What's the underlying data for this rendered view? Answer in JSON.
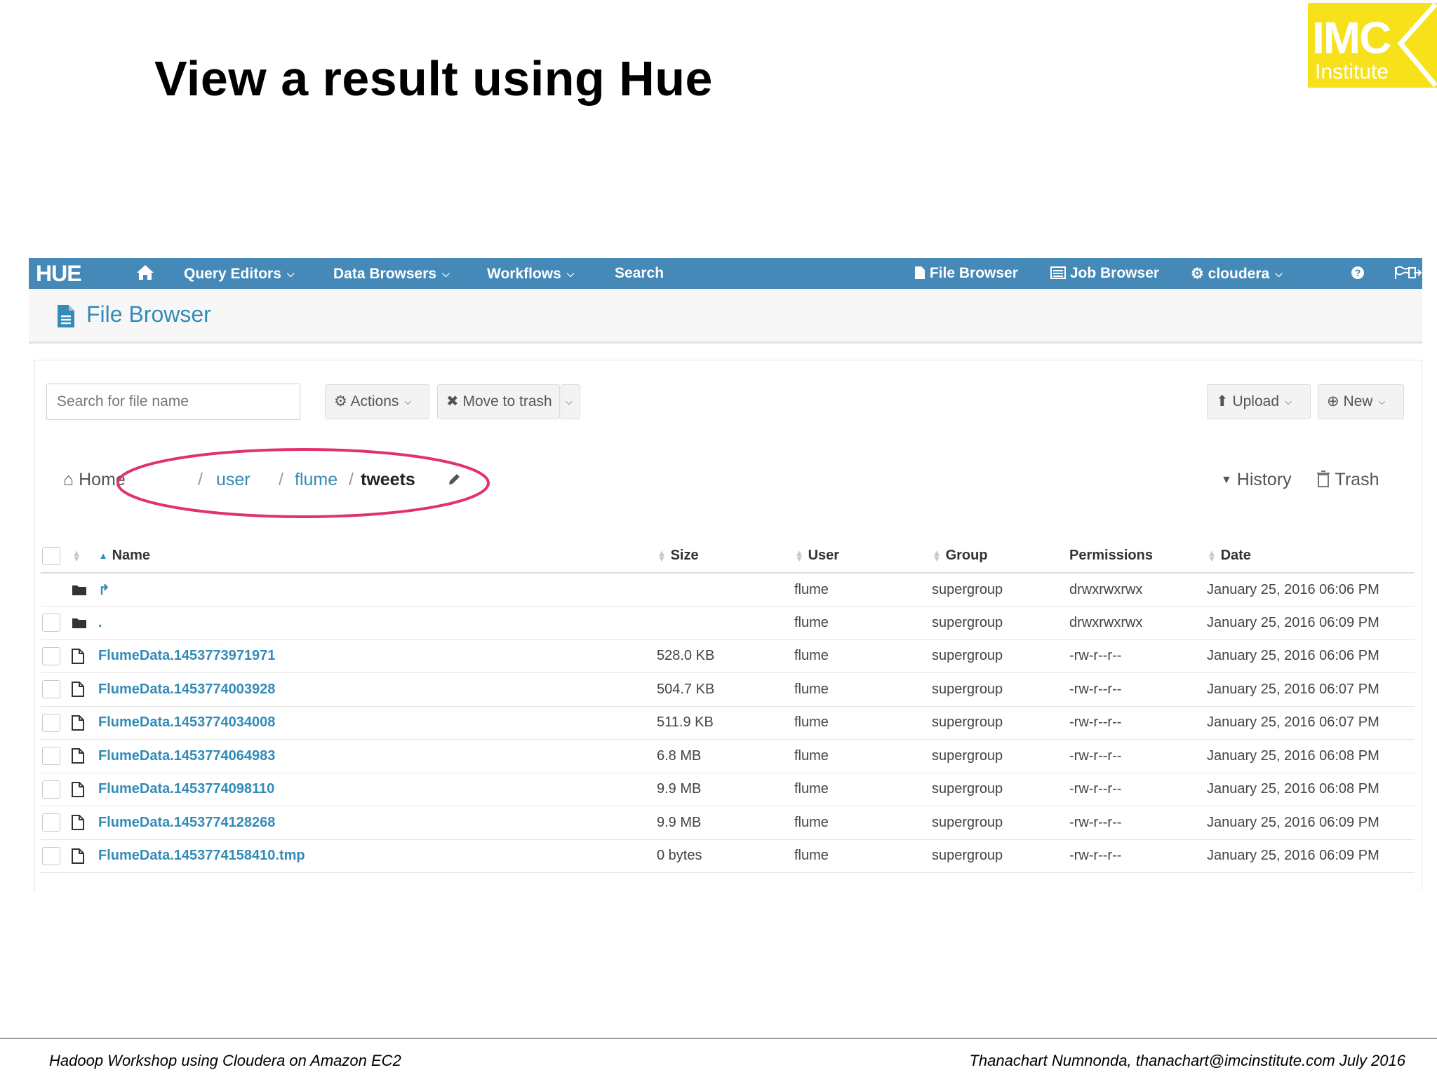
{
  "slide": {
    "title": "View a result using Hue",
    "logo_main": "IMC",
    "logo_sub": "Institute",
    "footer_left": "Hadoop Workshop using Cloudera on Amazon EC2",
    "footer_right": "Thanachart Numnonda,  thanachart@imcinstitute.com  July 2016"
  },
  "navbar": {
    "logo": "HUE",
    "items": [
      {
        "label": "Query Editors"
      },
      {
        "label": "Data Browsers"
      },
      {
        "label": "Workflows"
      },
      {
        "label": "Search"
      },
      {
        "label": "File Browser"
      },
      {
        "label": "Job Browser"
      },
      {
        "label": "cloudera"
      }
    ]
  },
  "page": {
    "title": "File Browser"
  },
  "toolbar": {
    "search_placeholder": "Search for file name",
    "actions_label": "Actions",
    "move_to_trash_label": "Move to trash",
    "upload_label": "Upload",
    "new_label": "New"
  },
  "breadcrumb": {
    "home": "Home",
    "parts": [
      "user",
      "flume"
    ],
    "current": "tweets",
    "history": "History",
    "trash": "Trash"
  },
  "table": {
    "columns": [
      "Name",
      "Size",
      "User",
      "Group",
      "Permissions",
      "Date"
    ],
    "rows": [
      {
        "type": "folder",
        "name": "",
        "size": "",
        "user": "flume",
        "group": "supergroup",
        "permissions": "drwxrwxrwx",
        "date": "January 25, 2016 06:06 PM"
      },
      {
        "type": "folder",
        "name": ".",
        "size": "",
        "user": "flume",
        "group": "supergroup",
        "permissions": "drwxrwxrwx",
        "date": "January 25, 2016 06:09 PM"
      },
      {
        "type": "file",
        "name": "FlumeData.1453773971971",
        "size": "528.0 KB",
        "user": "flume",
        "group": "supergroup",
        "permissions": "-rw-r--r--",
        "date": "January 25, 2016 06:06 PM"
      },
      {
        "type": "file",
        "name": "FlumeData.1453774003928",
        "size": "504.7 KB",
        "user": "flume",
        "group": "supergroup",
        "permissions": "-rw-r--r--",
        "date": "January 25, 2016 06:07 PM"
      },
      {
        "type": "file",
        "name": "FlumeData.1453774034008",
        "size": "511.9 KB",
        "user": "flume",
        "group": "supergroup",
        "permissions": "-rw-r--r--",
        "date": "January 25, 2016 06:07 PM"
      },
      {
        "type": "file",
        "name": "FlumeData.1453774064983",
        "size": "6.8 MB",
        "user": "flume",
        "group": "supergroup",
        "permissions": "-rw-r--r--",
        "date": "January 25, 2016 06:08 PM"
      },
      {
        "type": "file",
        "name": "FlumeData.1453774098110",
        "size": "9.9 MB",
        "user": "flume",
        "group": "supergroup",
        "permissions": "-rw-r--r--",
        "date": "January 25, 2016 06:08 PM"
      },
      {
        "type": "file",
        "name": "FlumeData.1453774128268",
        "size": "9.9 MB",
        "user": "flume",
        "group": "supergroup",
        "permissions": "-rw-r--r--",
        "date": "January 25, 2016 06:09 PM"
      },
      {
        "type": "file",
        "name": "FlumeData.1453774158410.tmp",
        "size": "0 bytes",
        "user": "flume",
        "group": "supergroup",
        "permissions": "-rw-r--r--",
        "date": "January 25, 2016 06:09 PM"
      }
    ]
  },
  "colors": {
    "navbar": "#4489b7",
    "link": "#338bb8",
    "highlight": "#e0336b",
    "logo_bg": "#f7e11a"
  }
}
